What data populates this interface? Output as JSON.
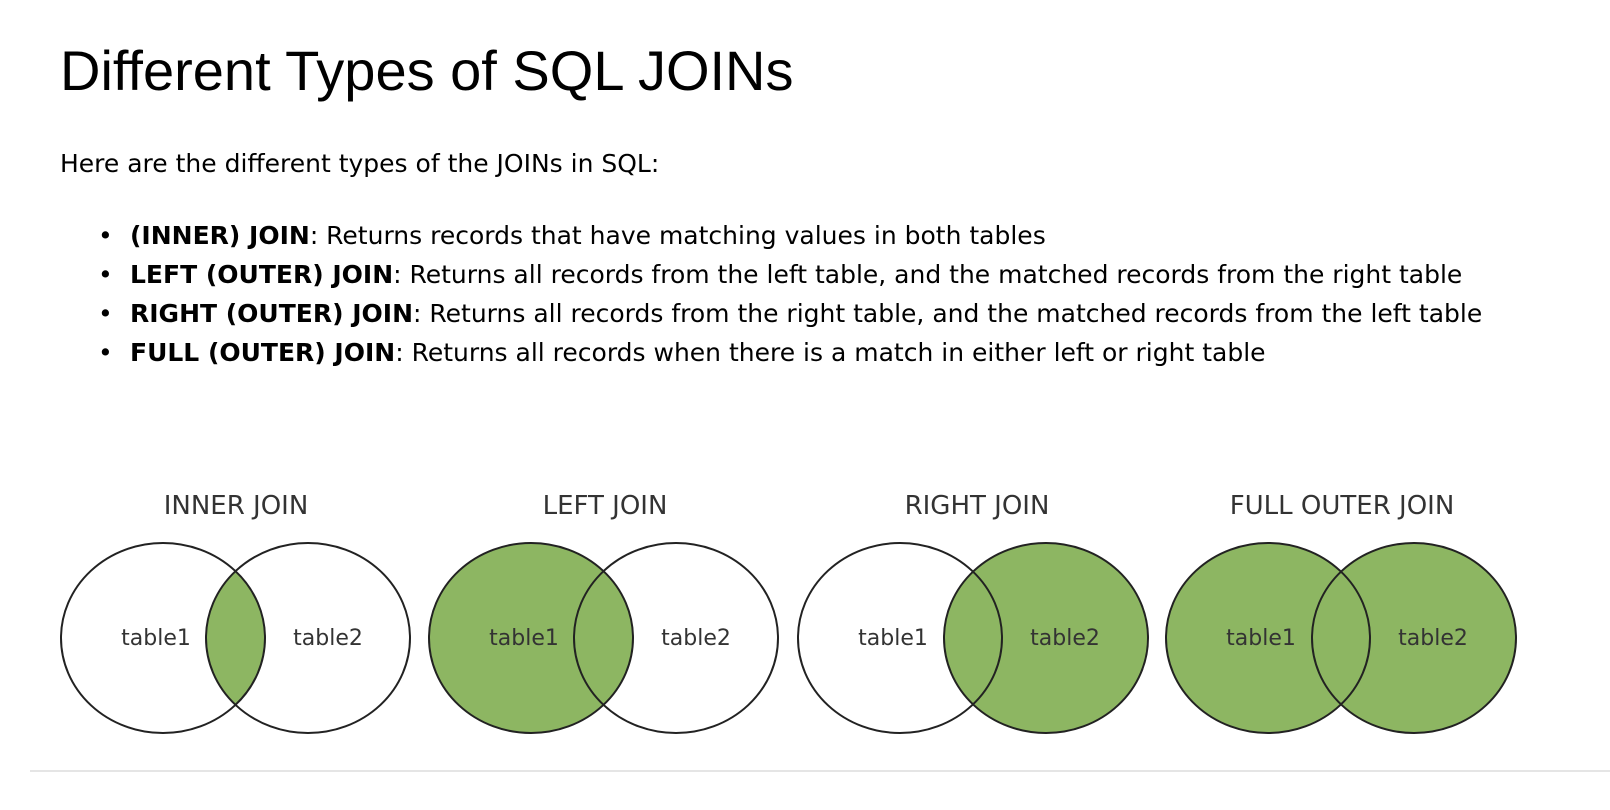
{
  "page": {
    "title": "Different Types of SQL JOINs",
    "intro": "Here are the different types of the JOINs in SQL:"
  },
  "joins": [
    {
      "term": "(INNER) JOIN",
      "description": ": Returns records that have matching values in both tables"
    },
    {
      "term": "LEFT (OUTER) JOIN",
      "description": ": Returns all records from the left table, and the matched records from the right table"
    },
    {
      "term": "RIGHT (OUTER) JOIN",
      "description": ": Returns all records from the right table, and the matched records from the left table"
    },
    {
      "term": "FULL (OUTER) JOIN",
      "description": ": Returns all records when there is a match in either left or right table"
    }
  ],
  "diagrams": [
    {
      "title": "INNER JOIN",
      "left_label": "table1",
      "right_label": "table2",
      "fill": "intersection"
    },
    {
      "title": "LEFT JOIN",
      "left_label": "table1",
      "right_label": "table2",
      "fill": "left"
    },
    {
      "title": "RIGHT JOIN",
      "left_label": "table1",
      "right_label": "table2",
      "fill": "right"
    },
    {
      "title": "FULL OUTER JOIN",
      "left_label": "table1",
      "right_label": "table2",
      "fill": "both"
    }
  ],
  "colors": {
    "fill": "#8db662",
    "stroke": "#222222",
    "label": "#333333"
  }
}
